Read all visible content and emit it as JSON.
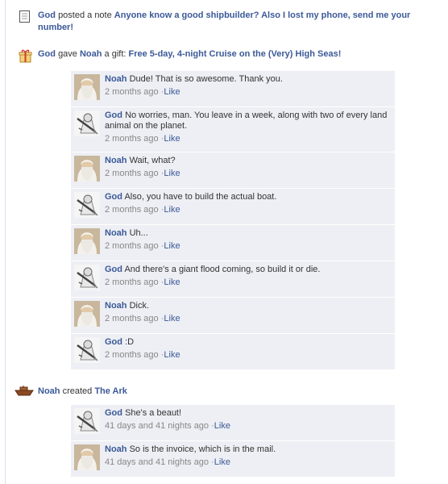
{
  "stories": [
    {
      "icon": "note-icon",
      "actor": "God",
      "verb": "posted a note",
      "target": "Anyone know a good shipbuilder? Also I lost my phone, send me your number!"
    },
    {
      "icon": "gift-icon",
      "actor": "God",
      "verb": "gave",
      "recipient": "Noah",
      "verb2": "a gift:",
      "target": "Free 5-day, 4-night Cruise on the (Very) High Seas!"
    },
    {
      "icon": "ark-icon",
      "actor": "Noah",
      "verb": "created",
      "target": "The Ark"
    }
  ],
  "comments_gift": [
    {
      "author": "Noah",
      "text": "Dude! That is so awesome. Thank you.",
      "time": "2 months ago",
      "like": "Like"
    },
    {
      "author": "God",
      "text": "No worries, man.  You leave in a week, along with two of every land animal on the planet.",
      "time": "2 months ago",
      "like": "Like"
    },
    {
      "author": "Noah",
      "text": "Wait, what?",
      "time": "2 months ago",
      "like": "Like"
    },
    {
      "author": "God",
      "text": "Also, you have to build the actual boat.",
      "time": "2 months ago",
      "like": "Like"
    },
    {
      "author": "Noah",
      "text": "Uh...",
      "time": "2 months ago",
      "like": "Like"
    },
    {
      "author": "God",
      "text": "And there's a giant flood coming, so build it or die.",
      "time": "2 months ago",
      "like": "Like"
    },
    {
      "author": "Noah",
      "text": "Dick.",
      "time": "2 months ago",
      "like": "Like"
    },
    {
      "author": "God",
      "text": ":D",
      "time": "2 months ago",
      "like": "Like"
    }
  ],
  "comments_ark": [
    {
      "author": "God",
      "text": "She's a beaut!",
      "time": "41 days and 41 nights ago",
      "like": "Like"
    },
    {
      "author": "Noah",
      "text": "So is the invoice, which is in the mail.",
      "time": "41 days and 41 nights ago",
      "like": "Like"
    }
  ]
}
